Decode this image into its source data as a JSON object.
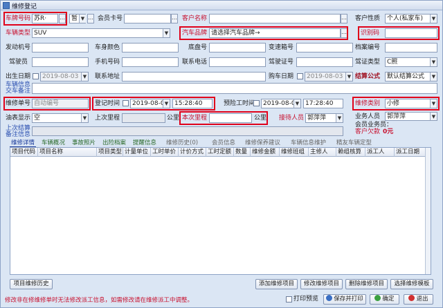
{
  "window": {
    "title": "维修登记"
  },
  "row1": {
    "plate_label": "车牌号码",
    "plate_value": "苏R·",
    "plate_suffix": "暂",
    "member_label": "会员卡号",
    "customer_name_label": "客户名称",
    "customer_type_label": "客户性质",
    "customer_type_value": "个人(私家车)"
  },
  "row2": {
    "car_type_label": "车辆类型",
    "car_type_value": "SUV",
    "brand_label": "汽车品牌",
    "brand_value": "请选择汽车品牌→",
    "vin_label": "识别码"
  },
  "row3": {
    "engine_label": "发动机号",
    "color_label": "车身颜色",
    "chassis_label": "底盘号",
    "gearbox_label": "变速箱号",
    "archive_label": "档案编号"
  },
  "row4": {
    "driver_label": "驾驶员",
    "mobile_label": "手机号码",
    "phone_label": "联系电话",
    "license_label": "驾驶证号",
    "license_type_label": "驾证类型",
    "license_type_value": "C照"
  },
  "row5": {
    "birth_label": "出生日期",
    "birth_value": "2019-08-03",
    "address_label": "联系地址",
    "buy_date_label": "购车日期",
    "buy_date_value": "2019-08-03",
    "settle_label": "结算公式",
    "settle_value": "默认结算公式"
  },
  "notes": {
    "car_info_label": "车辆信息",
    "delivery_label": "交车备注"
  },
  "row6": {
    "order_label": "维修单号",
    "order_value": "自动编号",
    "reg_time_label": "登记时间",
    "reg_date": "2019-08-03",
    "reg_time": "15:28:40",
    "eta_label": "预险工时间",
    "eta_date": "2019-08-03",
    "eta_time": "17:28:40",
    "repair_type_label": "维修类别",
    "repair_type_value": "小修"
  },
  "row7": {
    "oil_label": "油表显示",
    "oil_value": "空",
    "last_mileage_label": "上次里程",
    "km_unit": "公里",
    "this_mileage_label": "本次里程",
    "km_unit2": "公里",
    "receiver_label": "接待人员",
    "receiver_value": "郭萍萍",
    "sales_label": "业务人员",
    "sales_value": "郭萍萍",
    "member_sales_label": "会员业务员：",
    "debt_label": "客户欠款",
    "debt_value": "0元"
  },
  "row8": {
    "last_settle_label": "上次结算",
    "remark_label": "备注信息"
  },
  "tabs": [
    "维修详情",
    "车辆概况",
    "事故照片",
    "出险档案",
    "提醒信息",
    "维修历史(0)",
    "会员信息",
    "维修保养建议",
    "车辆信息维护",
    "精友车辆定型"
  ],
  "grid": {
    "columns": [
      "项目代码",
      "项目名称",
      "项目类型",
      "计量单位",
      "工时单价",
      "计价方式",
      "工时定额",
      "数量",
      "维修金额",
      "维修班组",
      "主修人",
      "赖组核算",
      "派工人",
      "派工日期"
    ]
  },
  "buttons": {
    "history": "项目维修历史",
    "add": "添加维修项目",
    "modify": "修改维修项目",
    "delete": "删除维修项目",
    "template": "选择维修模板",
    "print_label": "打印预览",
    "save_print": "保存并打印",
    "ok": "确定",
    "exit": "退出"
  },
  "status": {
    "message": "修改非在修维修单时无法修改派工信息，如需修改请在维修派工中调整。"
  }
}
